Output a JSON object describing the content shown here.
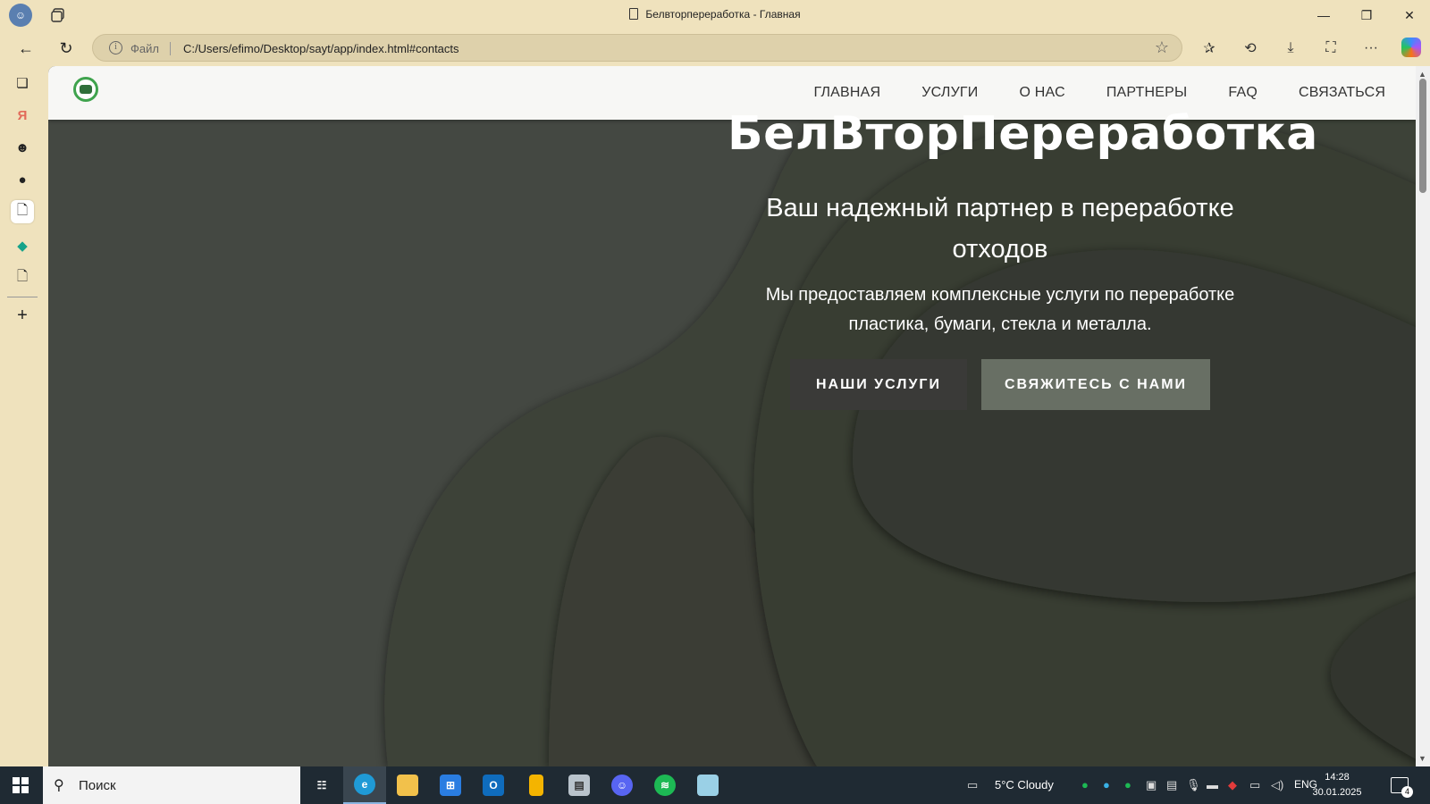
{
  "browser": {
    "window_title": "Белвторпереработка - Главная",
    "address": {
      "scheme_label": "Файл",
      "url": "C:/Users/efimo/Desktop/sayt/app/index.html#contacts"
    }
  },
  "site": {
    "nav": [
      "ГЛАВНАЯ",
      "УСЛУГИ",
      "О НАС",
      "ПАРТНЕРЫ",
      "FAQ",
      "СВЯЗАТЬСЯ"
    ],
    "hero": {
      "title": "БелВторПереработка",
      "subtitle": "Ваш надежный партнер в переработке отходов",
      "description": "Мы предоставляем комплексные услуги по переработке пластика, бумаги, стекла и металла.",
      "btn_services": "НАШИ УСЛУГИ",
      "btn_contact": "СВЯЖИТЕСЬ С НАМИ"
    }
  },
  "taskbar": {
    "search_label": "Поиск",
    "weather": "5°C  Cloudy",
    "language": "ENG",
    "time": "14:28",
    "date": "30.01.2025",
    "notifications": "4"
  },
  "colors": {
    "browser_chrome": "#efe2bd",
    "hero_bg": "#3b3f37",
    "button_dark": "#3a3a38",
    "button_grey": "#686f64",
    "taskbar": "#1f2a33"
  }
}
